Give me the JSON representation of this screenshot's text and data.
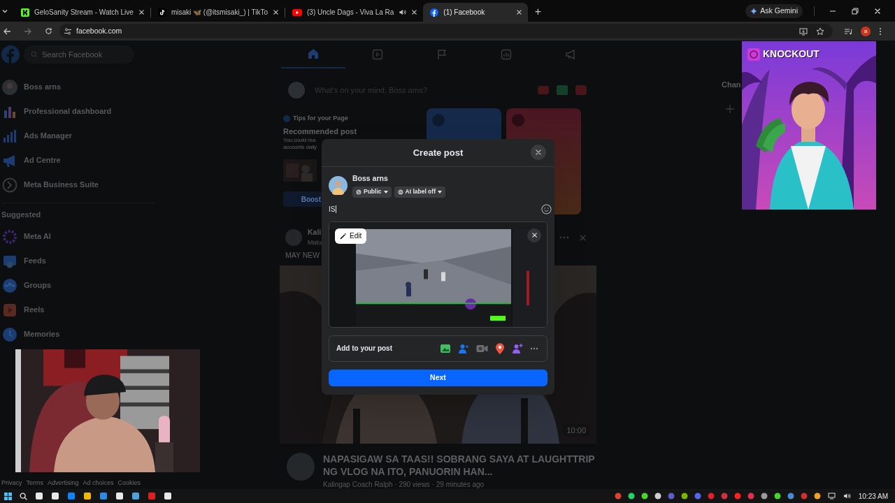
{
  "browser": {
    "tabs": [
      {
        "title": "GeloSanity Stream - Watch Live",
        "kind": "kick",
        "audio": false,
        "selected": false
      },
      {
        "title": "misaki 🦋 (@itsmisaki_) | TikTo",
        "kind": "tiktok",
        "audio": false,
        "selected": false
      },
      {
        "title": "(3) Uncle Dags - Viva La Ra",
        "kind": "youtube",
        "audio": true,
        "selected": false
      },
      {
        "title": "(1) Facebook",
        "kind": "facebook",
        "audio": false,
        "selected": true
      }
    ],
    "new_tab": "+",
    "ask_button": "Ask Gemini",
    "address": "facebook.com",
    "profile_initial": "a"
  },
  "facebook": {
    "search_placeholder": "Search Facebook",
    "shortcuts": [
      {
        "label": "Boss arns"
      },
      {
        "label": "Professional dashboard"
      },
      {
        "label": "Ads Manager"
      },
      {
        "label": "Ad Centre"
      },
      {
        "label": "Meta Business Suite"
      }
    ],
    "suggested_heading": "Suggested",
    "suggested": [
      {
        "label": "Meta AI"
      },
      {
        "label": "Feeds"
      },
      {
        "label": "Groups"
      },
      {
        "label": "Reels"
      },
      {
        "label": "Memories"
      }
    ],
    "footer": [
      "Privacy",
      "Terms",
      "Advertising",
      "Ad choices",
      "Cookies"
    ],
    "composer_placeholder": "What's on your mind, Boss arns?",
    "tips": {
      "label": "Tips for your Page",
      "title": "Recommended post",
      "lines": [
        "You could rea",
        "accounts daily"
      ],
      "button": "Boost"
    },
    "post": {
      "author": "Kali",
      "subline": "Matu",
      "caption": "MAY NEW",
      "duration": "10:00",
      "title": "NAPASIGAW SA TAAS!! SOBRANG SAYA AT LAUGHTTRIP NG VLOG NA ITO, PANUORIN HAN...",
      "meta": "Kalingap Coach Ralph · 290 views · 29 minutes ago"
    },
    "right_heading": "Chan"
  },
  "dialog": {
    "title": "Create post",
    "author": "Boss arns",
    "audience": "Public",
    "ai_label": "AI label off",
    "text": "IS",
    "edit_button": "Edit",
    "add_label": "Add to your post",
    "next_button": "Next"
  },
  "overlay": {
    "title": "KNOCKOUT"
  },
  "taskbar": {
    "time": "10:23 AM"
  }
}
